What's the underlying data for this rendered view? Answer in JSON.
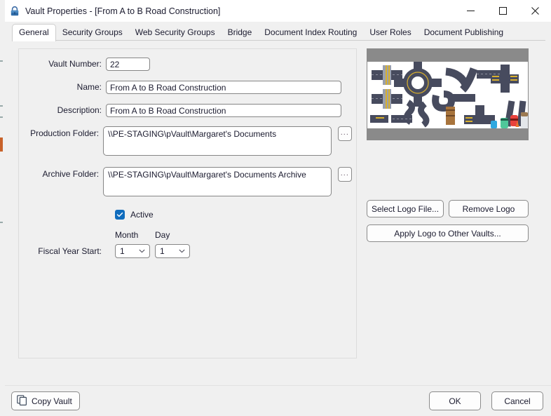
{
  "window": {
    "title": "Vault Properties - [From A to B Road Construction]",
    "lock_icon": "lock-icon",
    "controls": {
      "minimize": "minimize-icon",
      "maximize": "maximize-icon",
      "close": "close-icon"
    }
  },
  "tabs": [
    {
      "label": "General",
      "active": true
    },
    {
      "label": "Security Groups",
      "active": false
    },
    {
      "label": "Web Security Groups",
      "active": false
    },
    {
      "label": "Bridge",
      "active": false
    },
    {
      "label": "Document Index Routing",
      "active": false
    },
    {
      "label": "User Roles",
      "active": false
    },
    {
      "label": "Document Publishing",
      "active": false
    }
  ],
  "form": {
    "vault_number": {
      "label": "Vault Number:",
      "value": "22"
    },
    "name": {
      "label": "Name:",
      "value": "From A to B Road Construction"
    },
    "description": {
      "label": "Description:",
      "value": "From A to B Road Construction"
    },
    "production_folder": {
      "label": "Production Folder:",
      "value": "\\\\PE-STAGING\\pVault\\Margaret's Documents",
      "browse_label": "..."
    },
    "archive_folder": {
      "label": "Archive Folder:",
      "value": "\\\\PE-STAGING\\pVault\\Margaret's Documents Archive",
      "browse_label": "..."
    },
    "active": {
      "label": "Active",
      "checked": true
    },
    "fiscal_year_start": {
      "label": "Fiscal Year Start:",
      "month_header": "Month",
      "day_header": "Day",
      "month_value": "1",
      "day_value": "1"
    }
  },
  "logo_panel": {
    "image_alt": "road-construction-logo",
    "select_logo": "Select Logo File...",
    "remove_logo": "Remove Logo",
    "apply_logo": "Apply Logo to Other Vaults..."
  },
  "footer": {
    "copy_vault": "Copy Vault",
    "copy_icon": "copy-icon",
    "ok": "OK",
    "cancel": "Cancel"
  },
  "colors": {
    "accent": "#0f6cbd",
    "window_bg": "#f0f0f0",
    "titlebar_bg": "#ffffff",
    "text": "#1b1b2f",
    "border": "#8a8a8a"
  }
}
